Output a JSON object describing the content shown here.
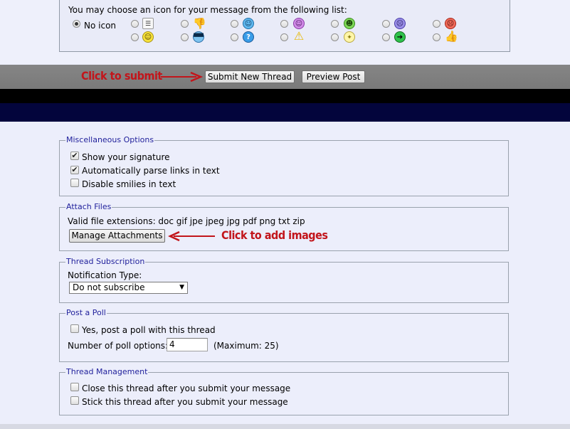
{
  "icons": {
    "prompt": "You may choose an icon for your message from the following list:",
    "no_icon_label": "No icon",
    "row1": [
      "post-icon",
      "thumbs-down-icon",
      "cool-smiley-icon",
      "tongue-smiley-icon",
      "grin-smiley-icon",
      "sad-smiley-icon",
      "angry-smiley-icon"
    ],
    "row2": [
      "smile-icon",
      "sunglasses-icon",
      "question-icon",
      "exclamation-icon",
      "lightbulb-icon",
      "arrow-right-icon",
      "thumbs-up-icon"
    ]
  },
  "submit_bar": {
    "submit_label": "Submit New Thread",
    "preview_label": "Preview Post",
    "annotation": "Click to submit"
  },
  "misc": {
    "legend": "Miscellaneous Options",
    "show_signature": "Show your signature",
    "parse_links": "Automatically parse links in text",
    "disable_smilies": "Disable smilies in text"
  },
  "attach": {
    "legend": "Attach Files",
    "extensions": "Valid file extensions: doc gif jpe jpeg jpg pdf png txt zip",
    "manage_label": "Manage Attachments",
    "annotation": "Click to add images"
  },
  "subscription": {
    "legend": "Thread Subscription",
    "notification_label": "Notification Type:",
    "selected": "Do not subscribe"
  },
  "poll": {
    "legend": "Post a Poll",
    "yes_label": "Yes, post a poll with this thread",
    "options_label": "Number of poll options:",
    "options_value": "4",
    "maximum": "(Maximum: 25)"
  },
  "management": {
    "legend": "Thread Management",
    "close_label": "Close this thread after you submit your message",
    "stick_label": "Stick this thread after you submit your message"
  },
  "colors": {
    "annotation": "#c2151b",
    "legend_text": "#22229c",
    "navy_band": "#03053c"
  }
}
